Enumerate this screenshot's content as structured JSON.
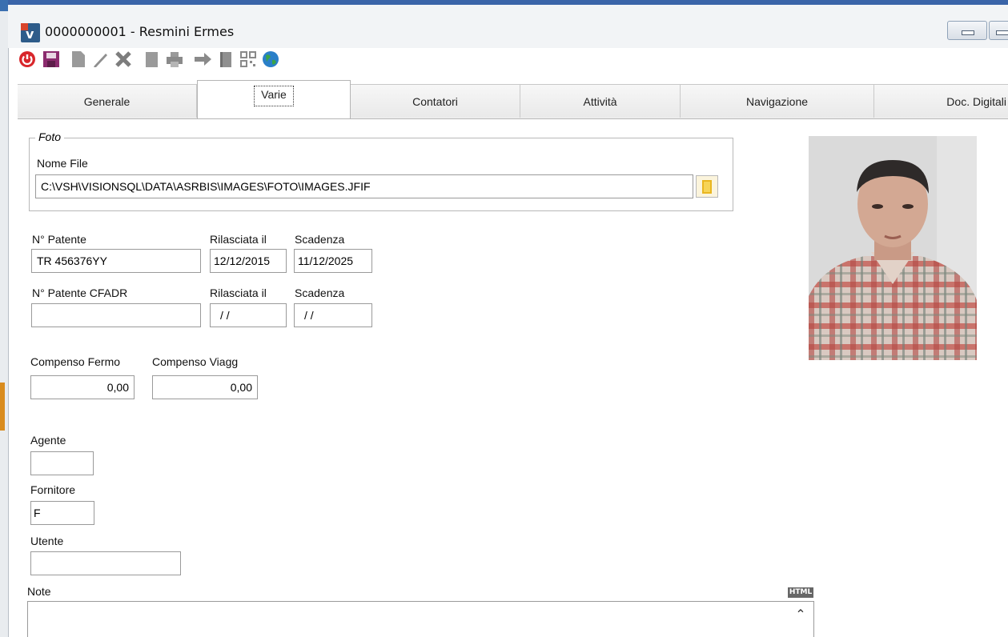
{
  "window": {
    "title": "0000000001 - Resmini Ermes",
    "app_icon_letter": "v"
  },
  "toolbar": {
    "icons": [
      "power-icon",
      "save-icon",
      "new-document-icon",
      "edit-pencil-icon",
      "delete-x-icon",
      "copy-document-icon",
      "print-icon",
      "forward-arrow-icon",
      "book-icon",
      "qr-code-icon",
      "globe-icon"
    ]
  },
  "tabs": [
    {
      "label": "Generale"
    },
    {
      "label": "Varie",
      "active": true
    },
    {
      "label": "Contatori"
    },
    {
      "label": "Attività"
    },
    {
      "label": "Navigazione"
    },
    {
      "label": "Doc. Digitali"
    }
  ],
  "foto": {
    "legend": "Foto",
    "file_label": "Nome File",
    "file_value": "C:\\VSH\\VISIONSQL\\DATA\\ASRBIS\\IMAGES\\FOTO\\IMAGES.JFIF"
  },
  "patente": {
    "label": "N° Patente",
    "value": "TR 456376YY",
    "issued_label": "Rilasciata il",
    "issued_value": "12/12/2015",
    "expiry_label": "Scadenza",
    "expiry_value": "11/12/2025"
  },
  "patente_cfadr": {
    "label": "N° Patente CFADR",
    "value": "",
    "issued_label": "Rilasciata il",
    "issued_value": "/ /",
    "expiry_label": "Scadenza",
    "expiry_value": "/ /"
  },
  "compensi": {
    "fermo_label": "Compenso Fermo",
    "fermo_value": "0,00",
    "viaggio_label": "Compenso Viagg",
    "viaggio_value": "0,00"
  },
  "agente": {
    "label": "Agente",
    "value": ""
  },
  "fornitore": {
    "label": "Fornitore",
    "value": "F"
  },
  "utente": {
    "label": "Utente",
    "value": ""
  },
  "note": {
    "label": "Note",
    "badge": "HTML",
    "value": ""
  },
  "colors": {
    "tab_bg": "#f0f0f0",
    "field_border": "#9a9a9a",
    "title_bar": "#f2f4f6"
  }
}
